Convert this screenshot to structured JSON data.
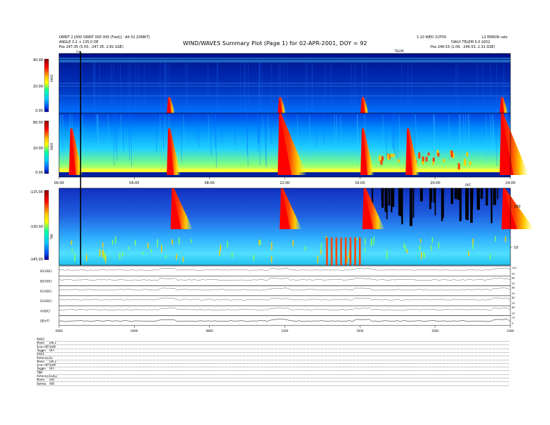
{
  "header": {
    "title": "WIND/WAVES Summary Plot (Page 1) for 02-APR-2001, DOY = 92",
    "left_line1": "ORBIT 2 [000 ORBIT 000 000 (Fwd)]  -  Alt 01 [ORBIT]",
    "left_line2": "ANGLE 3.2 + 135.0 DE",
    "left_line3": "Pos     247.35 (5.55, -247.35, 2.81 GSE)",
    "right_line0": "1.10 WED 2UT00",
    "right_line0b": "L2 ERROR rate",
    "right_line1": "DAILY TELEM 3.0 2002",
    "right_line2": "Pos     246.53 (1.06, -246.53, 2.31 GSE)",
    "telemetry_label": "TELEM",
    "tick_marker": "Cal"
  },
  "chart_data": [
    {
      "type": "heatmap",
      "name": "RAD2",
      "ylabel": "RAD2",
      "y_ticks": [
        "40.00",
        "20.00",
        "0.00"
      ],
      "colorbar": [
        "#8a0000",
        "#ff0000",
        "#ffcc00",
        "#ffff00",
        "#00ffaa",
        "#00ccff",
        "#0055ff",
        "#00008b"
      ],
      "bursts_hours": [
        5.8,
        11.7,
        16.1,
        23.5
      ]
    },
    {
      "type": "heatmap",
      "name": "RAD1",
      "ylabel": "RAD1",
      "y_ticks": [
        "80.00",
        "20.00",
        "0.00"
      ],
      "bursts_hours": [
        0.6,
        5.8,
        11.7,
        16.1,
        18.5,
        23.5
      ],
      "x_tick_labels": [
        "00:00",
        "04:00",
        "08:00",
        "12:00",
        "16:00",
        "20:00",
        "24:00"
      ],
      "x_marker_label": "DRT"
    },
    {
      "type": "heatmap",
      "name": "TNR",
      "ylabel": "TNR",
      "y_ticks": [
        "-115.00",
        "-130.00",
        "-145.00"
      ],
      "right_ticks": [
        "100",
        "10"
      ],
      "bursts_hours": [
        6.0,
        11.8,
        16.2,
        23.6
      ]
    },
    {
      "type": "line",
      "name": "panels",
      "rows": [
        {
          "label": "B1(ADC)",
          "r_top": "120",
          "r_mid": "50"
        },
        {
          "label": "B2(ADC)",
          "r_top": "80",
          "r_mid": "25"
        },
        {
          "label": "E1(ADC)",
          "r_top": "80",
          "r_mid": "25"
        },
        {
          "label": "E2(ADC)",
          "r_top": "80",
          "r_mid": "25"
        },
        {
          "label": "A(ADC)",
          "r_top": "80",
          "r_mid": "25"
        },
        {
          "label": "|B|(nT)",
          "r_top": "15",
          "r_mid": "5"
        }
      ],
      "x_tick_labels": [
        "0000",
        "0400",
        "0800",
        "1200",
        "1600",
        "2000",
        "2400"
      ]
    }
  ],
  "footer": {
    "rows": [
      {
        "lab": "RAD2",
        "val": ""
      },
      {
        "lab": "Mode",
        "val": "LIN 2"
      },
      {
        "lab": "Scan Off",
        "val": "SUM"
      },
      {
        "lab": "Toggle",
        "val": "OFF"
      },
      {
        "lab": "RAD1",
        "val": ""
      },
      {
        "lab": "Antenna",
        "val": "Ex"
      },
      {
        "lab": "Mode",
        "val": "LIN 2"
      },
      {
        "lab": "Scan Off",
        "val": "SUM"
      },
      {
        "lab": "Toggle",
        "val": "OFF"
      },
      {
        "lab": "TNR",
        "val": ""
      },
      {
        "lab": "Antenna",
        "val": "Ex/Ey"
      },
      {
        "lab": "Mode",
        "val": "A/B"
      },
      {
        "lab": "Sweep",
        "val": "A/B"
      }
    ]
  }
}
